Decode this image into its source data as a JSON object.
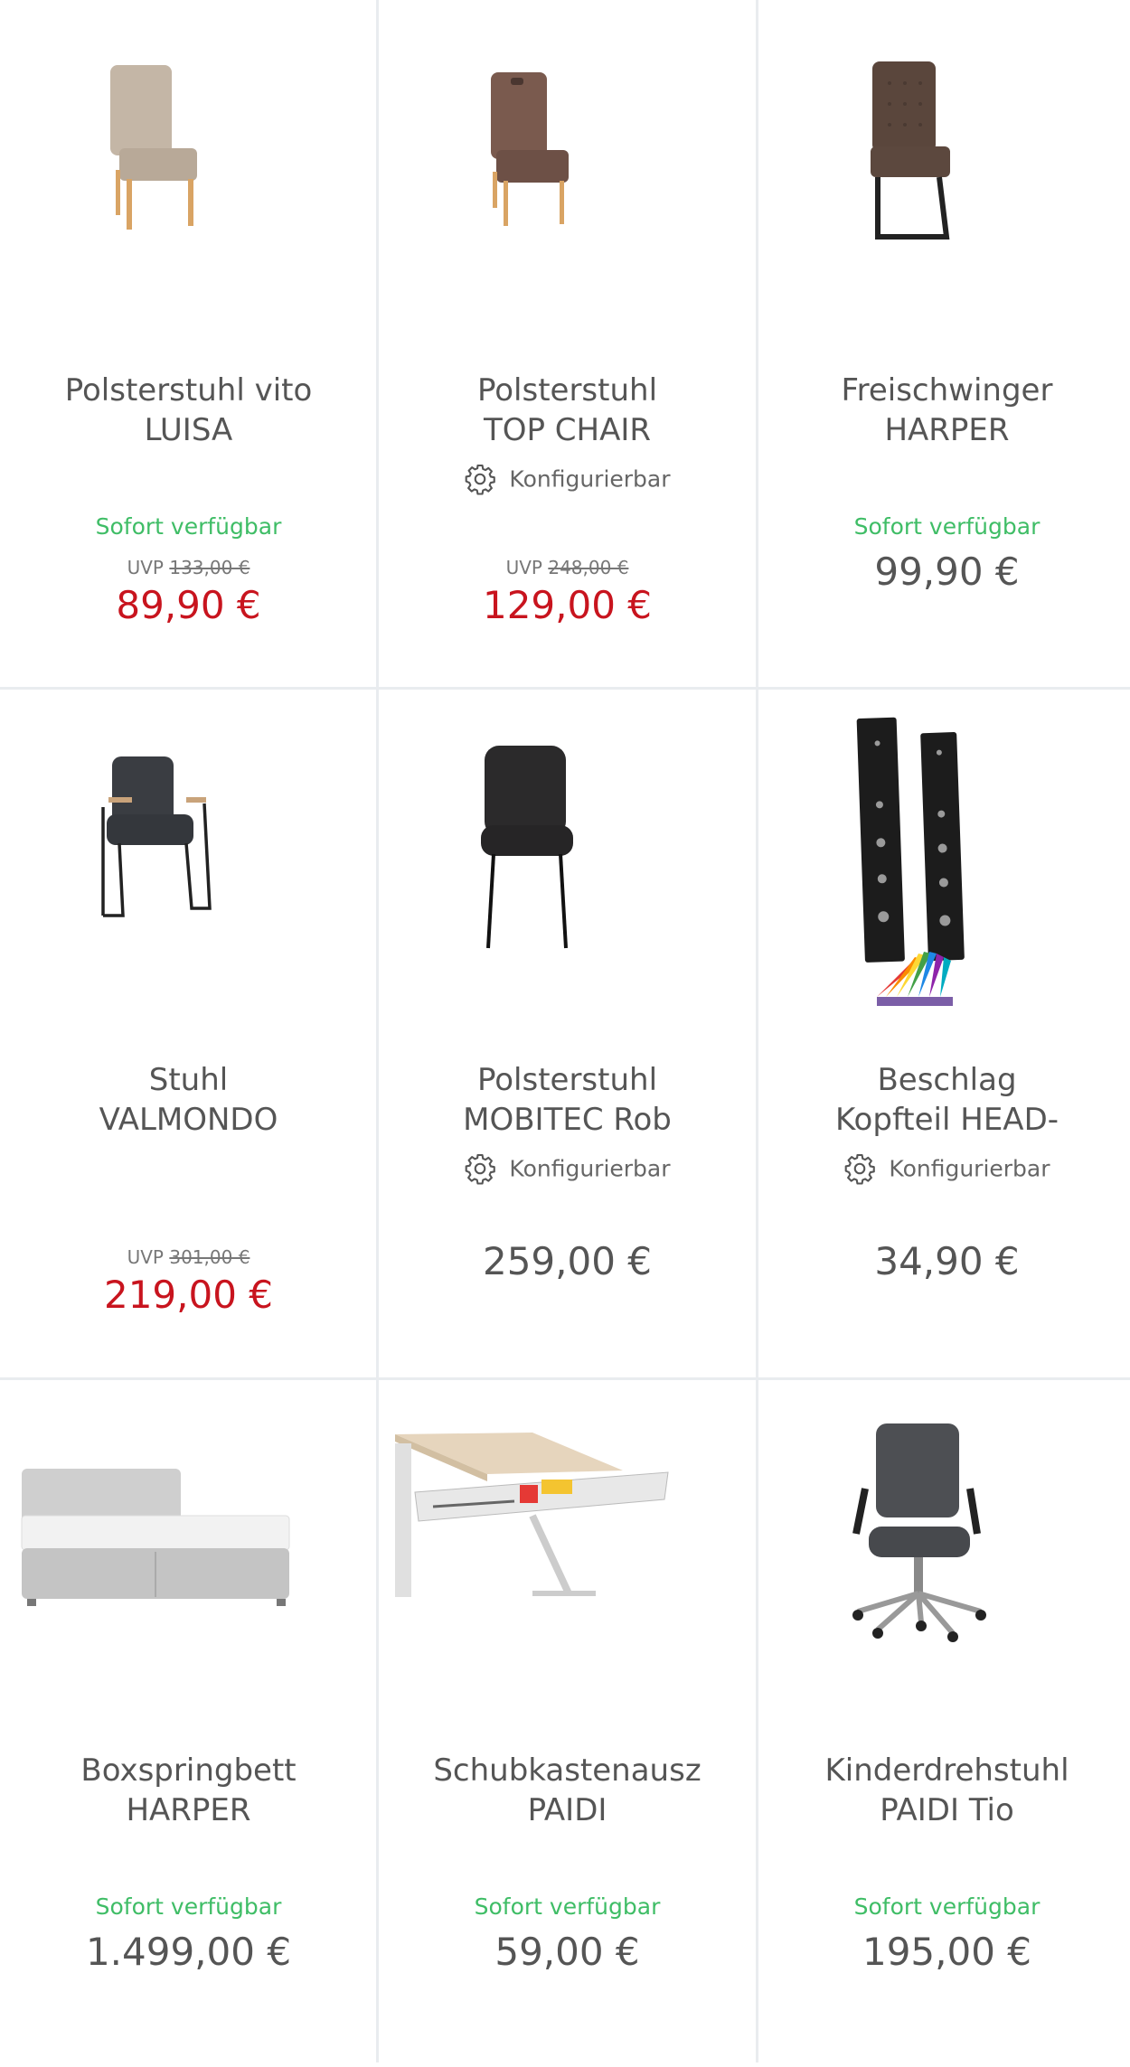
{
  "colors": {
    "accent_sale": "#c8141e",
    "available_green": "#3fbd66",
    "text_gray": "#555555",
    "divider": "#e9ecef"
  },
  "products": [
    {
      "title_line1": "Polsterstuhl vito",
      "title_line2": "LUISA",
      "availability": "Sofort verfügbar",
      "uvp_label": "UVP",
      "uvp_price": "133,00 €",
      "price": "89,90 €",
      "configurable": "",
      "image_icon": "beige-upholstered-chair"
    },
    {
      "title_line1": "Polsterstuhl",
      "title_line2": "TOP CHAIR",
      "availability": "",
      "uvp_label": "UVP",
      "uvp_price": "248,00 €",
      "price": "129,00 €",
      "configurable": "Konfigurierbar",
      "image_icon": "brown-upholstered-chair"
    },
    {
      "title_line1": "Freischwinger",
      "title_line2": "HARPER",
      "availability": "Sofort verfügbar",
      "uvp_label": "",
      "uvp_price": "",
      "price": "99,90 €",
      "configurable": "",
      "image_icon": "cantilever-chair"
    },
    {
      "title_line1": "Stuhl",
      "title_line2": "VALMONDO",
      "availability": "",
      "uvp_label": "UVP",
      "uvp_price": "301,00 €",
      "price": "219,00 €",
      "configurable": "",
      "image_icon": "armchair-metal-frame"
    },
    {
      "title_line1": "Polsterstuhl",
      "title_line2": "MOBITEC Rob",
      "availability": "",
      "uvp_label": "",
      "uvp_price": "",
      "price": "259,00 €",
      "configurable": "Konfigurierbar",
      "image_icon": "black-upholstered-chair"
    },
    {
      "title_line1": "Beschlag",
      "title_line2": "Kopfteil HEAD-",
      "availability": "",
      "uvp_label": "",
      "uvp_price": "",
      "price": "34,90 €",
      "configurable": "Konfigurierbar",
      "image_icon": "headboard-fitting"
    },
    {
      "title_line1": "Boxspringbett",
      "title_line2": "HARPER",
      "availability": "Sofort verfügbar",
      "uvp_label": "",
      "uvp_price": "",
      "price": "1.499,00 €",
      "configurable": "",
      "image_icon": "boxspring-bed"
    },
    {
      "title_line1": "Schubkastenausz",
      "title_line2": "PAIDI",
      "availability": "Sofort verfügbar",
      "uvp_label": "",
      "uvp_price": "",
      "price": "59,00 €",
      "configurable": "",
      "image_icon": "desk-drawer"
    },
    {
      "title_line1": "Kinderdrehstuhl",
      "title_line2": "PAIDI Tio",
      "availability": "Sofort verfügbar",
      "uvp_label": "",
      "uvp_price": "",
      "price": "195,00 €",
      "configurable": "",
      "image_icon": "office-swivel-chair"
    }
  ]
}
